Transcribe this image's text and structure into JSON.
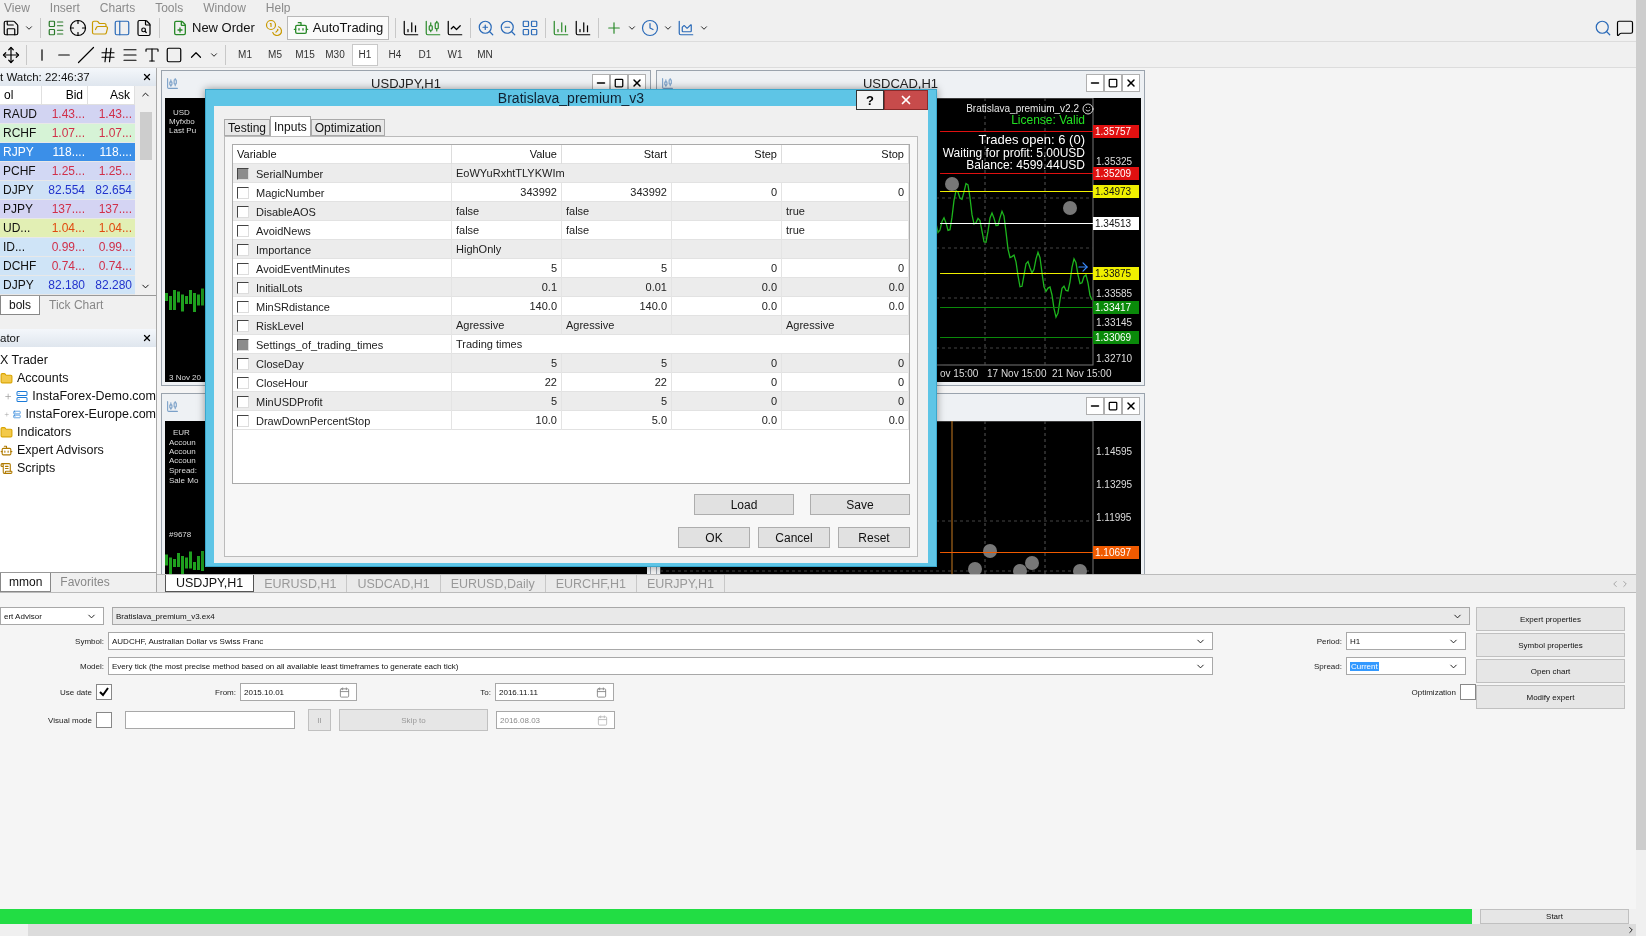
{
  "menu": [
    "View",
    "Insert",
    "Charts",
    "Tools",
    "Window",
    "Help"
  ],
  "toolbar": {
    "buttons": [
      "New Order",
      "AutoTrading"
    ],
    "periods": [
      {
        "label": "M1",
        "selected": false
      },
      {
        "label": "M5",
        "selected": false
      },
      {
        "label": "M15",
        "selected": false
      },
      {
        "label": "M30",
        "selected": false
      },
      {
        "label": "H1",
        "selected": true
      },
      {
        "label": "H4",
        "selected": false
      },
      {
        "label": "D1",
        "selected": false
      },
      {
        "label": "W1",
        "selected": false
      },
      {
        "label": "MN",
        "selected": false
      }
    ]
  },
  "market_watch": {
    "title": "t Watch: 22:46:37",
    "columns": [
      "ol",
      "Bid",
      "Ask"
    ],
    "rows": [
      {
        "symbol": "RAUD",
        "bid": "1.43...",
        "ask": "1.43...",
        "color": "#d2d4f2",
        "kind": "down",
        "selected": false
      },
      {
        "symbol": "RCHF",
        "bid": "1.07...",
        "ask": "1.07...",
        "color": "#d6f3d6",
        "kind": "down",
        "selected": false
      },
      {
        "symbol": "RJPY",
        "bid": "118....",
        "ask": "118....",
        "color": "#3b8fe8",
        "kind": "down",
        "selected": true
      },
      {
        "symbol": "PCHF",
        "bid": "1.25...",
        "ask": "1.25...",
        "color": "#d2d8f4",
        "kind": "down",
        "selected": false
      },
      {
        "symbol": "DJPY",
        "bid": "82.554",
        "ask": "82.654",
        "color": "#cfe2f6",
        "kind": "up",
        "selected": false
      },
      {
        "symbol": "PJPY",
        "bid": "137....",
        "ask": "137....",
        "color": "#d4d4f3",
        "kind": "down",
        "selected": false
      },
      {
        "symbol": "UD...",
        "bid": "1.04...",
        "ask": "1.04...",
        "color": "#e2efb4",
        "kind": "alert",
        "selected": false
      },
      {
        "symbol": "ID...",
        "bid": "0.99...",
        "ask": "0.99...",
        "color": "#cfe4f7",
        "kind": "down",
        "selected": false
      },
      {
        "symbol": "DCHF",
        "bid": "0.74...",
        "ask": "0.74...",
        "color": "#cfe4f7",
        "kind": "down",
        "selected": false
      },
      {
        "symbol": "DJPY",
        "bid": "82.180",
        "ask": "82.280",
        "color": "#cfe4f7",
        "kind": "up",
        "selected": false
      }
    ],
    "tabs": [
      {
        "label": "bols",
        "selected": true
      },
      {
        "label": "Tick Chart",
        "selected": false
      }
    ]
  },
  "navigator": {
    "title": "ator",
    "tree": [
      {
        "label": "X Trader",
        "kind": "root",
        "children": [
          {
            "label": "Accounts",
            "kind": "accounts",
            "children": [
              {
                "label": "InstaForex-Demo.com",
                "kind": "server"
              },
              {
                "label": "InstaForex-Europe.com",
                "kind": "server"
              }
            ]
          },
          {
            "label": "Indicators",
            "kind": "folder"
          },
          {
            "label": "Expert Advisors",
            "kind": "experts"
          },
          {
            "label": "Scripts",
            "kind": "scripts"
          }
        ]
      }
    ],
    "tabs": [
      {
        "label": "mmon",
        "selected": true
      },
      {
        "label": "Favorites",
        "selected": false
      }
    ]
  },
  "charts": [
    {
      "title": "USDJPY,H1",
      "kind": "strip",
      "notes": [
        "USD",
        "Myfxbo",
        "Last Pu",
        "3 Nov 20"
      ]
    },
    {
      "title": "USDCAD,H1",
      "kind": "full",
      "overlay": [
        {
          "text": "Bratislava_premium_v2.2",
          "kind": "caption"
        },
        {
          "text": "License: Valid",
          "kind": "status"
        },
        {
          "text": "Trades open: 6 (0)",
          "kind": "info"
        },
        {
          "text": "Waiting for profit: 5.00USD",
          "kind": "info"
        },
        {
          "text": "Balance: 4599.44USD",
          "kind": "info"
        }
      ],
      "axis": [
        {
          "text": "1.35757",
          "kind": "tag",
          "color": "#e01010"
        },
        {
          "text": "1.35325",
          "kind": "tick"
        },
        {
          "text": "1.35209",
          "kind": "tag",
          "color": "#e01010"
        },
        {
          "text": "1.34973",
          "kind": "tag",
          "color": "#f0f000"
        },
        {
          "text": "1.34513",
          "kind": "tag",
          "color": "#ffffff"
        },
        {
          "text": "1.33875",
          "kind": "tag",
          "color": "#f0f000"
        },
        {
          "text": "1.33585",
          "kind": "tick"
        },
        {
          "text": "1.33417",
          "kind": "tag",
          "color": "#0a8a0a"
        },
        {
          "text": "1.33145",
          "kind": "tick"
        },
        {
          "text": "1.33069",
          "kind": "tag",
          "color": "#0a8a0a"
        },
        {
          "text": "1.32710",
          "kind": "tick"
        }
      ],
      "dates": [
        "ov 15:00",
        "17 Nov 15:00",
        "21 Nov 15:00"
      ]
    },
    {
      "kind": "strip",
      "notes": [
        "EUR",
        "Accoun",
        "Accoun",
        "Accoun",
        "Spread:",
        "Sale Mo",
        "#9678"
      ]
    },
    {
      "kind": "full",
      "axis": [
        {
          "text": "1.14595",
          "kind": "tick"
        },
        {
          "text": "1.13295",
          "kind": "tick"
        },
        {
          "text": "1.11995",
          "kind": "tick"
        },
        {
          "text": "1.10697",
          "kind": "tag",
          "color": "#f05a00"
        }
      ]
    }
  ],
  "chart_tabs": [
    {
      "label": "USDJPY,H1",
      "selected": true
    },
    {
      "label": "EURUSD,H1",
      "selected": false
    },
    {
      "label": "USDCAD,H1",
      "selected": false
    },
    {
      "label": "EURUSD,Daily",
      "selected": false
    },
    {
      "label": "EURCHF,H1",
      "selected": false
    },
    {
      "label": "EURJPY,H1",
      "selected": false
    }
  ],
  "dialog": {
    "title": "Bratislava_premium_v3",
    "help": "?",
    "tabs": [
      {
        "label": "Testing",
        "selected": false
      },
      {
        "label": "Inputs",
        "selected": true
      },
      {
        "label": "Optimization",
        "selected": false
      }
    ],
    "columns": [
      "Variable",
      "Value",
      "Start",
      "Step",
      "Stop"
    ],
    "rows": [
      {
        "name": "SerialNumber",
        "kind": "wide",
        "checked": false,
        "disabled": true,
        "value": "EoWYuRxhtTLYKWIm"
      },
      {
        "name": "MagicNumber",
        "kind": "number",
        "checked": false,
        "disabled": false,
        "value": "343992",
        "start": "343992",
        "step": "0",
        "stop": "0"
      },
      {
        "name": "DisableAOS",
        "kind": "text",
        "checked": false,
        "disabled": false,
        "value": "false",
        "start": "false",
        "stop": "true"
      },
      {
        "name": "AvoidNews",
        "kind": "text",
        "checked": false,
        "disabled": false,
        "value": "false",
        "start": "false",
        "stop": "true"
      },
      {
        "name": "Importance",
        "kind": "text",
        "checked": false,
        "disabled": false,
        "value": "HighOnly"
      },
      {
        "name": "AvoidEventMinutes",
        "kind": "number",
        "checked": false,
        "disabled": false,
        "value": "5",
        "start": "5",
        "step": "0",
        "stop": "0"
      },
      {
        "name": "InitialLots",
        "kind": "number",
        "checked": false,
        "disabled": false,
        "value": "0.1",
        "start": "0.01",
        "step": "0.0",
        "stop": "0.0"
      },
      {
        "name": "MinSRdistance",
        "kind": "number",
        "checked": false,
        "disabled": false,
        "value": "140.0",
        "start": "140.0",
        "step": "0.0",
        "stop": "0.0"
      },
      {
        "name": "RiskLevel",
        "kind": "text",
        "checked": false,
        "disabled": false,
        "value": "Agressive",
        "start": "Agressive",
        "stop": "Agressive"
      },
      {
        "name": "Settings_of_trading_times",
        "kind": "wide",
        "checked": false,
        "disabled": true,
        "value": "Trading times"
      },
      {
        "name": "CloseDay",
        "kind": "number",
        "checked": false,
        "disabled": false,
        "value": "5",
        "start": "5",
        "step": "0",
        "stop": "0"
      },
      {
        "name": "CloseHour",
        "kind": "number",
        "checked": false,
        "disabled": false,
        "value": "22",
        "start": "22",
        "step": "0",
        "stop": "0"
      },
      {
        "name": "MinUSDProfit",
        "kind": "number",
        "checked": false,
        "disabled": false,
        "value": "5",
        "start": "5",
        "step": "0",
        "stop": "0"
      },
      {
        "name": "DrawDownPercentStop",
        "kind": "number",
        "checked": false,
        "disabled": false,
        "value": "10.0",
        "start": "5.0",
        "step": "0.0",
        "stop": "0.0"
      }
    ],
    "table_buttons": [
      "Load",
      "Save"
    ],
    "buttons": [
      "OK",
      "Cancel",
      "Reset"
    ]
  },
  "tester": {
    "expert_type": "ert Advisor",
    "expert": "Bratislava_premium_v3.ex4",
    "symbol_label": "Symbol:",
    "symbol": "AUDCHF, Australian Dollar vs Swiss Franc",
    "model_label": "Model:",
    "model": "Every tick (the most precise method based on all available least timeframes to generate each tick)",
    "period_label": "Period:",
    "period": "H1",
    "spread_label": "Spread:",
    "spread": {
      "value": "Current",
      "selected": true
    },
    "use_date": {
      "label": "Use date",
      "checked": true
    },
    "from_label": "From:",
    "from": "2015.10.01",
    "to_label": "To:",
    "to": "2016.11.11",
    "visual_mode": {
      "label": "Visual mode",
      "checked": false
    },
    "pause": "II",
    "skip": {
      "label": "Skip to",
      "disabled": true
    },
    "skip_date": {
      "value": "2016.08.03",
      "disabled": true
    },
    "optimization": {
      "label": "Optimization",
      "checked": false
    },
    "side_buttons": [
      "Expert properties",
      "Symbol properties",
      "Open chart",
      "Modify expert"
    ],
    "progress": {
      "level": 1
    },
    "start": "Start"
  }
}
